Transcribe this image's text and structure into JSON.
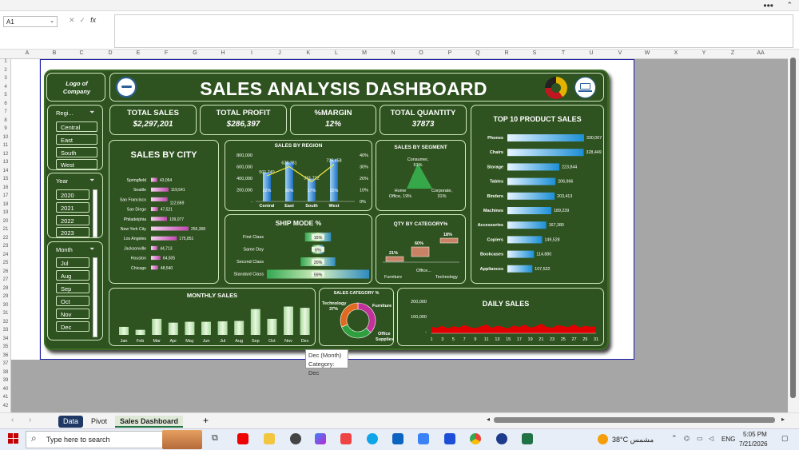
{
  "window": {
    "menu_dots": "•••",
    "caret": "⌃"
  },
  "formula_bar": {
    "name_box": "A1",
    "fx": "fx",
    "formula": ""
  },
  "columns": [
    "A",
    "B",
    "C",
    "D",
    "E",
    "F",
    "G",
    "H",
    "I",
    "J",
    "K",
    "L",
    "M",
    "N",
    "O",
    "P",
    "Q",
    "R",
    "S",
    "T",
    "U",
    "V",
    "W",
    "X",
    "Y",
    "Z",
    "AA"
  ],
  "rows": [
    "1",
    "2",
    "3",
    "4",
    "5",
    "6",
    "7",
    "8",
    "9",
    "10",
    "11",
    "12",
    "13",
    "14",
    "15",
    "16",
    "17",
    "18",
    "19",
    "20",
    "21",
    "22",
    "23",
    "24",
    "25",
    "26",
    "27",
    "28",
    "29",
    "30",
    "31",
    "32",
    "33",
    "34",
    "35",
    "36",
    "37",
    "38",
    "39",
    "40",
    "41",
    "42"
  ],
  "dashboard": {
    "logo": "Logo of Company",
    "title": "SALES ANALYSIS DASHBOARD",
    "kpis": [
      {
        "label": "TOTAL SALES",
        "value": "$2,297,201"
      },
      {
        "label": "TOTAL PROFIT",
        "value": "$286,397"
      },
      {
        "label": "%MARGIN",
        "value": "12%"
      },
      {
        "label": "TOTAL QUANTITY",
        "value": "37873"
      }
    ],
    "slicers": {
      "region": {
        "header": "Regi...",
        "items": [
          "Central",
          "East",
          "South",
          "West"
        ]
      },
      "year": {
        "header": "Year",
        "items": [
          "2020",
          "2021",
          "2022",
          "2023"
        ]
      },
      "month": {
        "header": "Month",
        "items": [
          "Jul",
          "Aug",
          "Sep",
          "Oct",
          "Nov",
          "Dec"
        ]
      }
    },
    "tooltip": {
      "line1": "Dec (Month)",
      "line2": "Category: Dec"
    }
  },
  "chart_data": [
    {
      "type": "bar",
      "title": "SALES BY CITY",
      "orientation": "horizontal",
      "categories": [
        "Springfield",
        "Seattle",
        "San Francisco",
        "San Diego",
        "Philadelphia",
        "New York City",
        "Los Angeles",
        "Jacksonville",
        "Houston",
        "Chicago"
      ],
      "values": [
        43054,
        119541,
        112669,
        47521,
        109077,
        256368,
        175851,
        44713,
        64505,
        48540
      ],
      "labels": [
        "43,054",
        "119,541",
        "112,669",
        "47,521",
        "109,077",
        "256,368",
        "175,851",
        "44,713",
        "64,505",
        "48,540"
      ]
    },
    {
      "type": "bar",
      "title": "SALES BY REGION",
      "categories": [
        "Central",
        "East",
        "South",
        "West"
      ],
      "values": [
        501240,
        678781,
        391722,
        725458
      ],
      "labels": [
        "501,240",
        "678,781",
        "391,722",
        "725,458"
      ],
      "line_values": [
        0.22,
        0.3,
        0.17,
        0.32
      ],
      "line_labels": [
        "22%",
        "30%",
        "17%",
        "32%"
      ],
      "yticks": [
        "800,000",
        "600,000",
        "400,000",
        "200,000",
        "-"
      ],
      "y2ticks": [
        "40%",
        "30%",
        "20%",
        "10%",
        "0%"
      ],
      "ylim": [
        0,
        800000
      ]
    },
    {
      "type": "area",
      "title": "SALES BY SEGMENT",
      "categories": [
        "Consumer",
        "Home Office",
        "Corporate"
      ],
      "values": [
        0.51,
        0.19,
        0.31
      ],
      "labels": [
        "Consumer, 51%",
        "Home Office, 19%",
        "Corporate, 31%"
      ]
    },
    {
      "type": "bar",
      "title": "TOP 10 PRODUCT SALES",
      "orientation": "horizontal",
      "categories": [
        "Phones",
        "Chairs",
        "Storage",
        "Tables",
        "Binders",
        "Machines",
        "Accessories",
        "Copiers",
        "Bookcases",
        "Appliances"
      ],
      "values": [
        330007,
        328449,
        223844,
        206966,
        203413,
        189239,
        167380,
        149528,
        114880,
        107532
      ],
      "labels": [
        "330,007",
        "328,449",
        "223,844",
        "206,966",
        "203,413",
        "189,239",
        "167,380",
        "149,528",
        "114,880",
        "107,532"
      ]
    },
    {
      "type": "bar",
      "title": "SHIP MODE %",
      "orientation": "horizontal",
      "categories": [
        "First Class",
        "Same Day",
        "Second Class",
        "Standard Class"
      ],
      "values": [
        0.15,
        0.06,
        0.2,
        0.59
      ],
      "labels": [
        "15%",
        "6%",
        "20%",
        "59%"
      ]
    },
    {
      "type": "bar",
      "title": "QTY BY CATEGORY%",
      "categories": [
        "Furniture",
        "Office...",
        "Technology"
      ],
      "values": [
        0.21,
        0.6,
        0.18
      ],
      "labels": [
        "21%",
        "60%",
        "18%"
      ]
    },
    {
      "type": "bar",
      "title": "MONTHLY SALES",
      "categories": [
        "Jan",
        "Feb",
        "Mar",
        "Apr",
        "May",
        "Jun",
        "Jul",
        "Aug",
        "Sep",
        "Oct",
        "Nov",
        "Dec"
      ],
      "values": [
        95000,
        60000,
        190000,
        145000,
        155000,
        155000,
        160000,
        165000,
        305000,
        190000,
        335000,
        320000
      ]
    },
    {
      "type": "pie",
      "title": "SALES CATEGORY %",
      "categories": [
        "Technology",
        "Furniture",
        "Office Supplies"
      ],
      "values": [
        0.37,
        0.32,
        0.31
      ],
      "labels": [
        "Technology, 37%",
        "Furniture",
        "Office Supplies"
      ],
      "colors": [
        "#c2309a",
        "#2e9e3e",
        "#e06a1f"
      ]
    },
    {
      "type": "area",
      "title": "DAILY SALES",
      "x": [
        "1",
        "3",
        "5",
        "7",
        "9",
        "11",
        "13",
        "15",
        "17",
        "19",
        "21",
        "23",
        "25",
        "27",
        "29",
        "31"
      ],
      "values": [
        95,
        80,
        110,
        70,
        105,
        85,
        120,
        90,
        75,
        100,
        130,
        80,
        110,
        95,
        70,
        115,
        90,
        125,
        85,
        100,
        140,
        95,
        80,
        120,
        105,
        90,
        130,
        85,
        110,
        95,
        100
      ],
      "yticks": [
        "200,000",
        "100,000",
        "-"
      ],
      "ylim": [
        0,
        200000
      ]
    }
  ],
  "sheet_tabs": [
    "Data",
    "Pivot",
    "Sales Dashboard"
  ],
  "add_sheet": "+",
  "taskbar": {
    "search_placeholder": "Type here to search",
    "weather": "38°C مشمس",
    "lang": "ENG",
    "time": "5:05 PM",
    "date": "7/21/2026"
  }
}
